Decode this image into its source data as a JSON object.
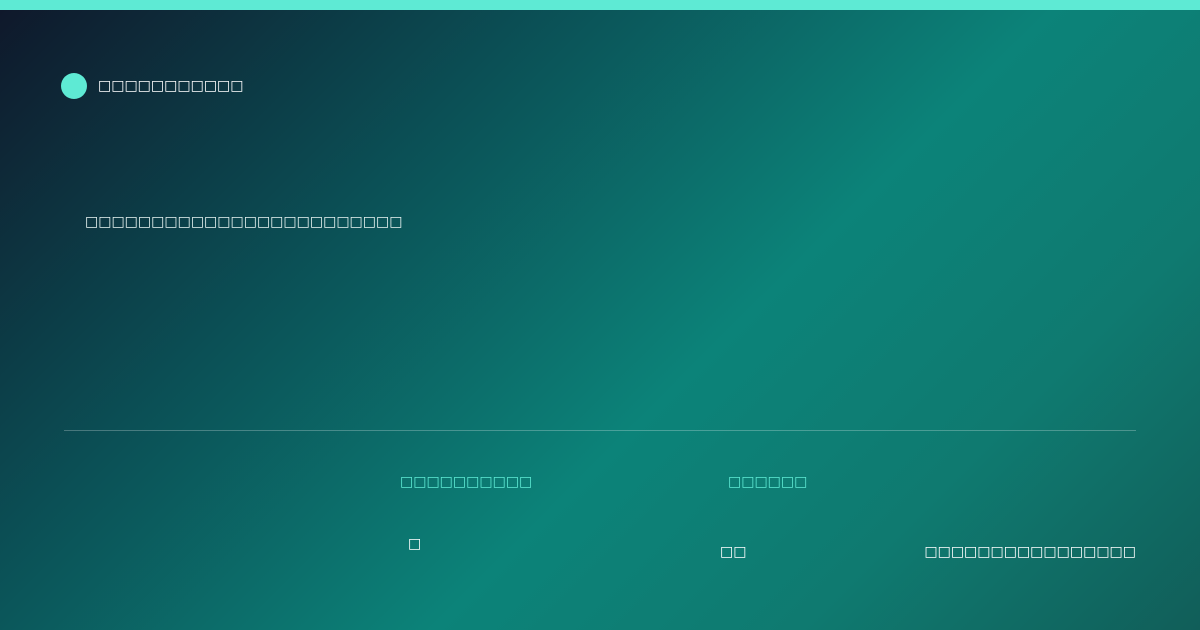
{
  "colors": {
    "accent": "#5eead4",
    "background_start": "#0f172a",
    "background_mid": "#0c8379",
    "background_end": "#115e59",
    "text": "#ffffff"
  },
  "brand": {
    "icon": "circle-dot-icon",
    "name": "□□□□□□□□□□□"
  },
  "headline": "□□□□□□□□□□□□□□□□□□□□□□□□",
  "stats": [
    {
      "label": "□□□□□□□□□□",
      "value": "□"
    },
    {
      "label": "□□□□□□",
      "value": "□□"
    },
    {
      "label": "",
      "value": "□□□□□□□□□□□□□□□□"
    }
  ]
}
